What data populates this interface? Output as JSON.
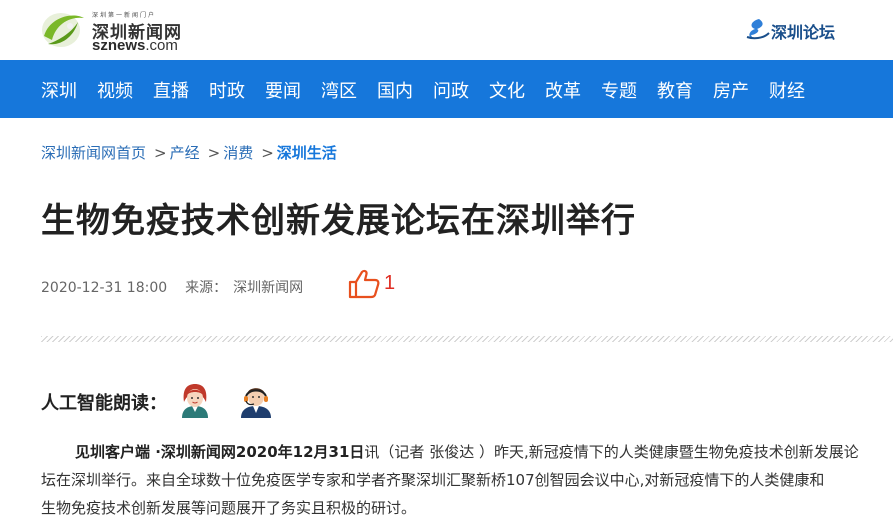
{
  "header": {
    "logo": {
      "slogan": "深圳第一新闻门户",
      "cn_name": "深圳新闻网",
      "en_name": "sznews",
      "en_suffix": ".com"
    },
    "forum_link": "深圳论坛"
  },
  "nav": {
    "items": [
      "深圳",
      "视频",
      "直播",
      "时政",
      "要闻",
      "湾区",
      "国内",
      "问政",
      "文化",
      "改革",
      "专题",
      "教育",
      "房产",
      "财经"
    ]
  },
  "breadcrumb": {
    "home": "深圳新闻网首页",
    "sep": ">",
    "level1": "产经",
    "level2": "消费",
    "current": "深圳生活"
  },
  "article": {
    "title": "生物免疫技术创新发展论坛在深圳举行",
    "datetime": "2020-12-31 18:00",
    "source_label": "来源：",
    "source": "深圳新闻网",
    "likes": "1"
  },
  "reader": {
    "label": "人工智能朗读："
  },
  "body": {
    "lead_bold": "见圳客户端 ·深圳新闻网2020年12月31日",
    "line1_rest": "讯（记者 张俊达 ）昨天,新冠疫情下的人类健康暨生物免疫技术创新发展论",
    "line2": "坛在深圳举行。来自全球数十位免疫医学专家和学者齐聚深圳汇聚新桥107创智园会议中心,对新冠疫情下的人类健康和",
    "line3": "生物免疫技术创新发展等问题展开了务实且积极的研讨。"
  },
  "colors": {
    "nav_bg": "#1677db",
    "link": "#2a6db6",
    "like_red": "#e02e24",
    "logo_green": "#7ab828"
  },
  "icons": [
    "logo-swoosh-icon",
    "forum-logo-icon",
    "thumbs-up-icon",
    "female-voice-icon",
    "male-voice-icon"
  ]
}
